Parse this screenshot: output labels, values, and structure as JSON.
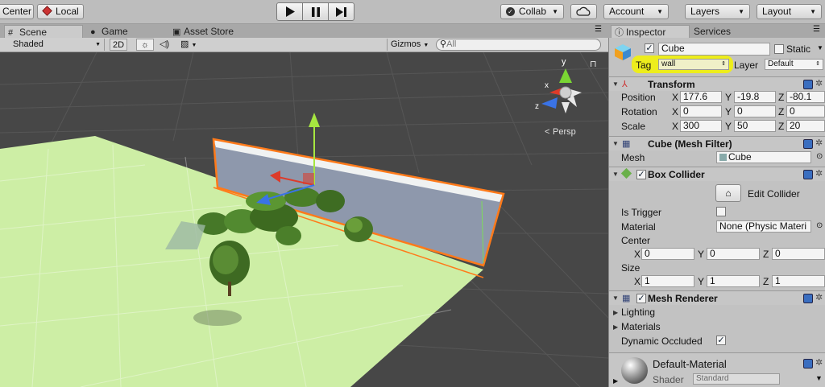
{
  "toolbar": {
    "center_label": "Center",
    "local_label": "Local",
    "collab_label": "Collab",
    "account_label": "Account",
    "layers_label": "Layers",
    "layout_label": "Layout"
  },
  "tabs": {
    "scene": "Scene",
    "game": "Game",
    "asset_store": "Asset Store",
    "inspector": "Inspector",
    "services": "Services"
  },
  "scene_toolbar": {
    "shading_mode": "Shaded",
    "mode_2d": "2D",
    "gizmos_label": "Gizmos",
    "search_placeholder": "All"
  },
  "gizmo": {
    "y_label": "y",
    "x_label": "x",
    "z_label": "z",
    "persp_label": "Persp"
  },
  "inspector": {
    "object_name": "Cube",
    "static_label": "Static",
    "tag_label": "Tag",
    "tag_value": "wall",
    "layer_label": "Layer",
    "layer_value": "Default",
    "transform": {
      "title": "Transform",
      "position_label": "Position",
      "rotation_label": "Rotation",
      "scale_label": "Scale",
      "x": "X",
      "y": "Y",
      "z": "Z",
      "position": [
        "177.6",
        "-19.8",
        "-80.1"
      ],
      "rotation": [
        "0",
        "0",
        "0"
      ],
      "scale": [
        "300",
        "50",
        "20"
      ]
    },
    "mesh_filter": {
      "title": "Cube (Mesh Filter)",
      "mesh_label": "Mesh",
      "mesh_value": "Cube"
    },
    "box_collider": {
      "title": "Box Collider",
      "edit_label": "Edit Collider",
      "is_trigger_label": "Is Trigger",
      "material_label": "Material",
      "material_value": "None (Physic Materi",
      "center_label": "Center",
      "size_label": "Size",
      "x": "X",
      "y": "Y",
      "z": "Z",
      "center": [
        "0",
        "0",
        "0"
      ],
      "size": [
        "1",
        "1",
        "1"
      ]
    },
    "mesh_renderer": {
      "title": "Mesh Renderer",
      "lighting_label": "Lighting",
      "materials_label": "Materials",
      "dynamic_occluded_label": "Dynamic Occluded"
    },
    "material": {
      "name": "Default-Material",
      "shader_label": "Shader",
      "shader_value": "Standard"
    }
  },
  "colors": {
    "selection_outline": "#ff7a1a",
    "tag_highlight": "#f2f20a",
    "ground": "#c8ee9a",
    "viewport_bg": "#474747"
  }
}
